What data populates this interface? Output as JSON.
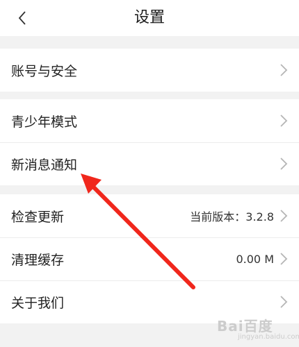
{
  "header": {
    "title": "设置",
    "back_icon": "chevron-left-icon"
  },
  "groups": [
    {
      "items": [
        {
          "label": "账号与安全",
          "value": ""
        }
      ]
    },
    {
      "items": [
        {
          "label": "青少年模式",
          "value": ""
        },
        {
          "label": "新消息通知",
          "value": ""
        }
      ]
    },
    {
      "items": [
        {
          "label": "检查更新",
          "value": "当前版本：3.2.8"
        },
        {
          "label": "清理缓存",
          "value": "0.00 M"
        },
        {
          "label": "关于我们",
          "value": ""
        }
      ]
    }
  ],
  "row_chevron_icon": "chevron-right-icon",
  "annotation": {
    "color": "#f0271c",
    "points_to": "新消息通知"
  },
  "watermark": {
    "text": "Bai百度",
    "sub": "jingyan.baidu.com"
  },
  "colors": {
    "background": "#f2f2f2",
    "surface": "#ffffff",
    "divider": "#ececec",
    "chevron": "#b5b5b5"
  }
}
